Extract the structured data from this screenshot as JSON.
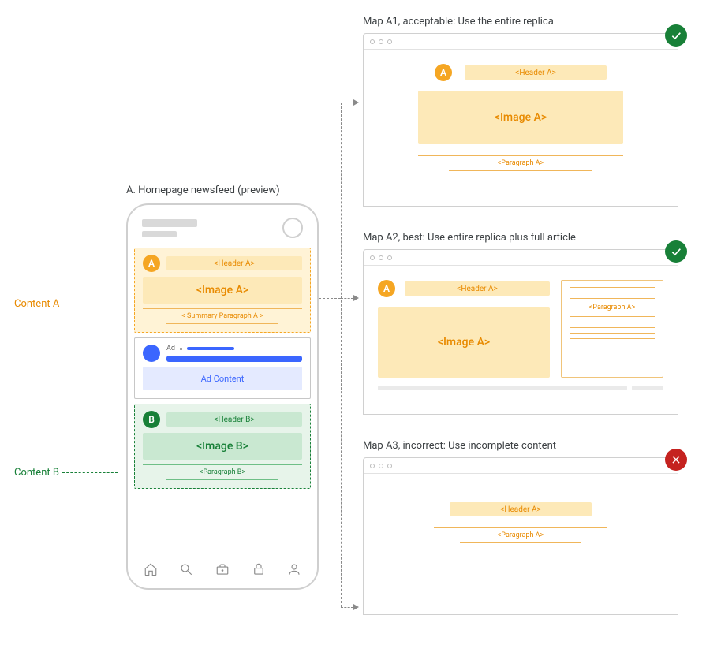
{
  "phone": {
    "title": "A. Homepage newsfeed (preview)",
    "nav_icons": [
      "home-icon",
      "search-icon",
      "briefcase-icon",
      "lock-icon",
      "user-icon"
    ]
  },
  "contentA": {
    "side_label": "Content A",
    "badge": "A",
    "header": "<Header A>",
    "image": "<Image A>",
    "paragraph": "< Summary Paragraph A >"
  },
  "ad": {
    "label": "Ad",
    "content": "Ad Content"
  },
  "contentB": {
    "side_label": "Content B",
    "badge": "B",
    "header": "<Header B>",
    "image": "<Image B>",
    "paragraph": "<Paragraph B>"
  },
  "maps": {
    "a1": {
      "label": "Map A1, acceptable: Use the entire replica",
      "status": "ok",
      "badge": "A",
      "header": "<Header A>",
      "image": "<Image A>",
      "paragraph": "<Paragraph A>"
    },
    "a2": {
      "label": "Map A2, best: Use entire replica plus full article",
      "status": "ok",
      "badge": "A",
      "header": "<Header A>",
      "image": "<Image A>",
      "paragraph": "<Paragraph A>"
    },
    "a3": {
      "label": "Map A3, incorrect: Use incomplete content",
      "status": "bad",
      "header": "<Header A>",
      "paragraph": "<Paragraph A>"
    }
  }
}
